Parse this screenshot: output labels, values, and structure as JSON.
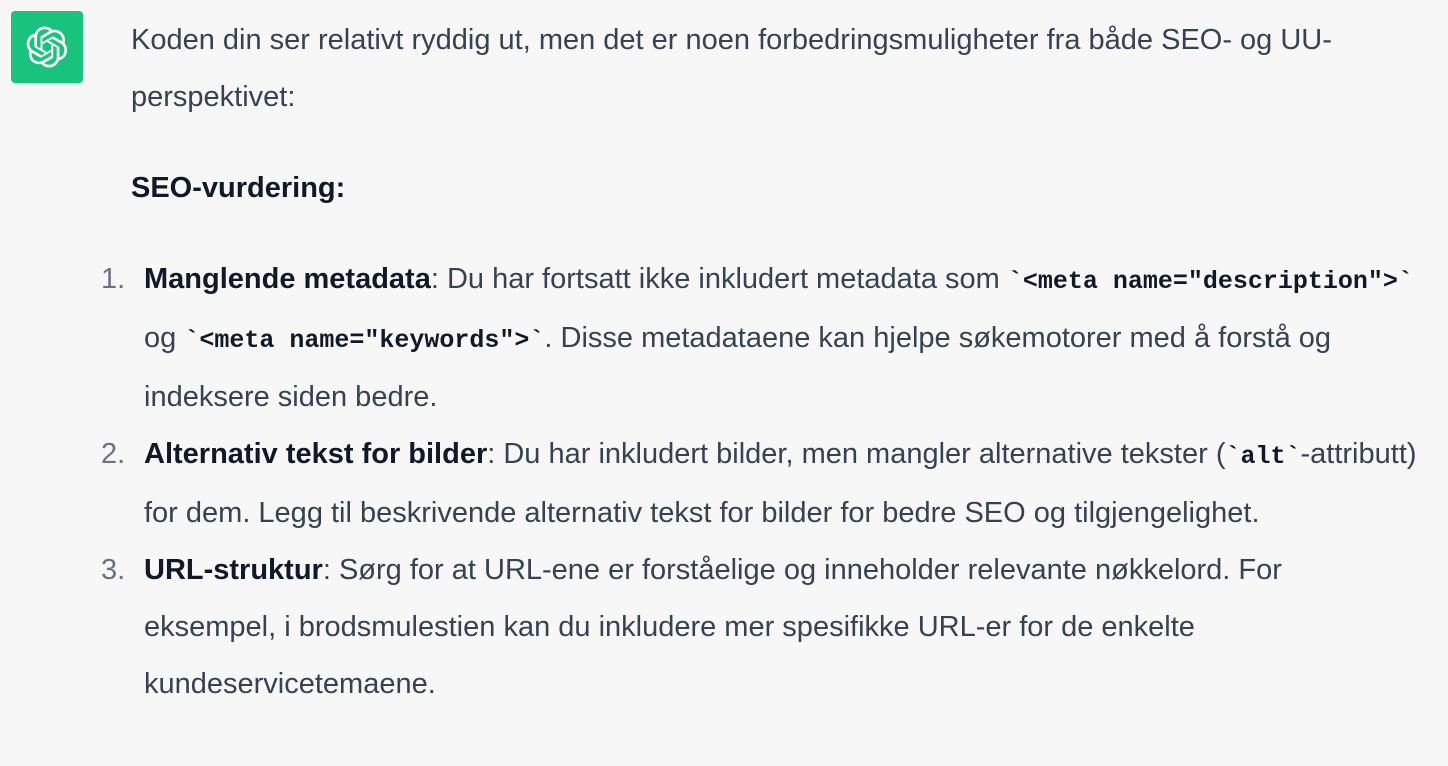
{
  "assistant": {
    "avatar_icon": "openai-logo-icon",
    "avatar_color": "#19c37d"
  },
  "message": {
    "intro": "Koden din ser relativt ryddig ut, men det er noen forbedringsmuligheter fra både SEO- og UU-perspektivet:",
    "heading": "SEO-vurdering:",
    "items": [
      {
        "number": "1.",
        "term": "Manglende metadata",
        "text_a": ": Du har fortsatt ikke inkludert metadata som ",
        "code_a": "`<meta name=\"description\">`",
        "text_b": " og ",
        "code_b": "`<meta name=\"keywords\">`",
        "text_c": ". Disse metadataene kan hjelpe søkemotorer med å forstå og indeksere siden bedre."
      },
      {
        "number": "2.",
        "term": "Alternativ tekst for bilder",
        "text_a": ": Du har inkludert bilder, men mangler alternative tekster (",
        "code_a": "`alt`",
        "text_b": "-attributt) for dem. Legg til beskrivende alternativ tekst for bilder for bedre SEO og tilgjengelighet."
      },
      {
        "number": "3.",
        "term": "URL-struktur",
        "text_a": ": Sørg for at URL-ene er forståelige og inneholder relevante nøkkelord. For eksempel, i brodsmulestien kan du inkludere mer spesifikke URL-er for de enkelte kundeservicetemaene."
      }
    ]
  }
}
